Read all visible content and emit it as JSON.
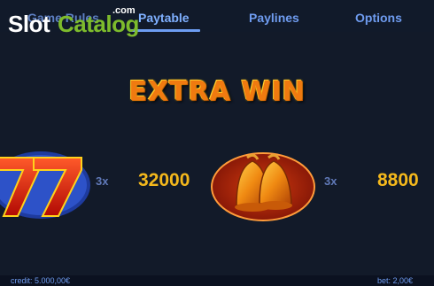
{
  "nav": {
    "tabs": [
      {
        "label": "Game Rules"
      },
      {
        "label": "Paytable",
        "active": true
      },
      {
        "label": "Paylines"
      },
      {
        "label": "Options"
      }
    ]
  },
  "watermark": {
    "slot": "Slot",
    "catalog": "Catalog",
    "com": ".com"
  },
  "paytable": {
    "heading": "EXTRA WIN",
    "rows": [
      {
        "symbol": "seven-icon",
        "multiplier": "3x",
        "payout": "32000"
      },
      {
        "symbol": "bells-icon",
        "multiplier": "3x",
        "payout": "8800"
      }
    ]
  },
  "footer": {
    "credit": "credit: 5.000,00€",
    "bet": "bet: 2,00€"
  },
  "colors": {
    "accent": "#6d9df2",
    "payout": "#f4b81c",
    "heading": "#f07a10",
    "background": "#121a29"
  }
}
